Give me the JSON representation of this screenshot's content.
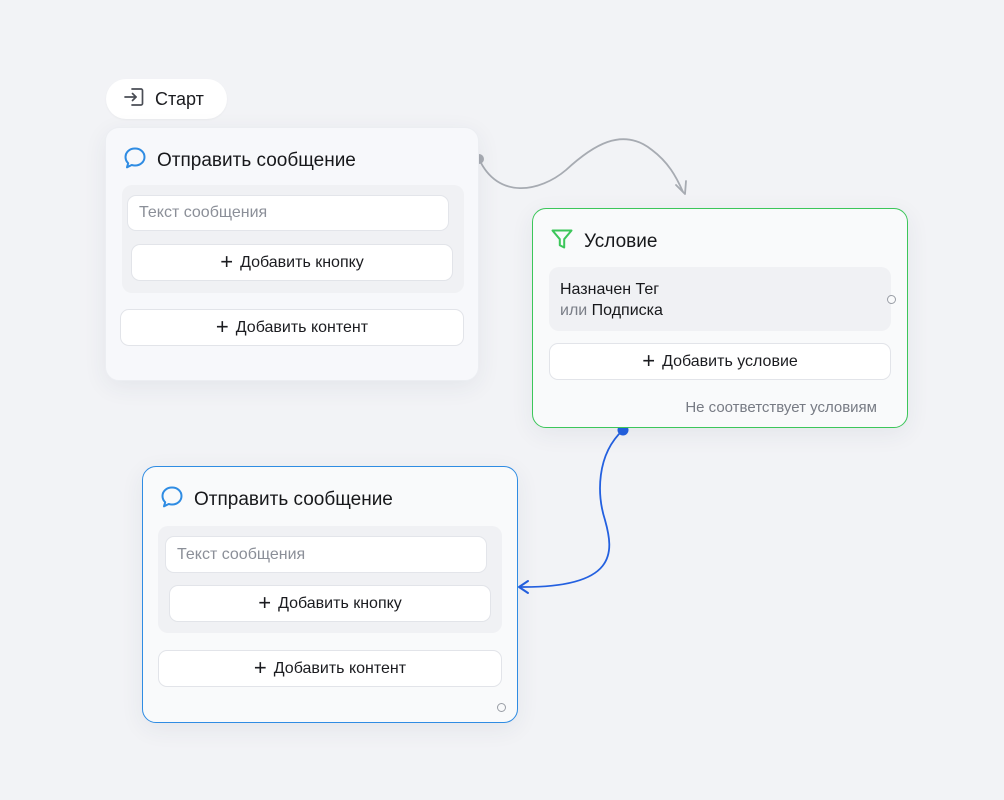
{
  "start": {
    "label": "Старт",
    "icon": "enter-arrow-icon"
  },
  "node_message_1": {
    "title": "Отправить сообщение",
    "icon": "chat-bubble-icon",
    "text_placeholder": "Текст сообщения",
    "add_button_label": "Добавить кнопку",
    "add_content_label": "Добавить контент"
  },
  "node_condition": {
    "title": "Условие",
    "icon": "filter-funnel-icon",
    "rule_line1": "Назначен Тег",
    "rule_or": "или",
    "rule_subscription": "Подписка",
    "add_condition_label": "Добавить условие",
    "no_match_label": "Не соответствует условиям"
  },
  "node_message_2": {
    "title": "Отправить сообщение",
    "icon": "chat-bubble-icon",
    "text_placeholder": "Текст сообщения",
    "add_button_label": "Добавить кнопку",
    "add_content_label": "Добавить контент"
  },
  "colors": {
    "condition_border": "#3cc65a",
    "selected_border": "#2f8ce3",
    "active_wire": "#2360e0",
    "inactive_wire": "#9a9ea6"
  }
}
